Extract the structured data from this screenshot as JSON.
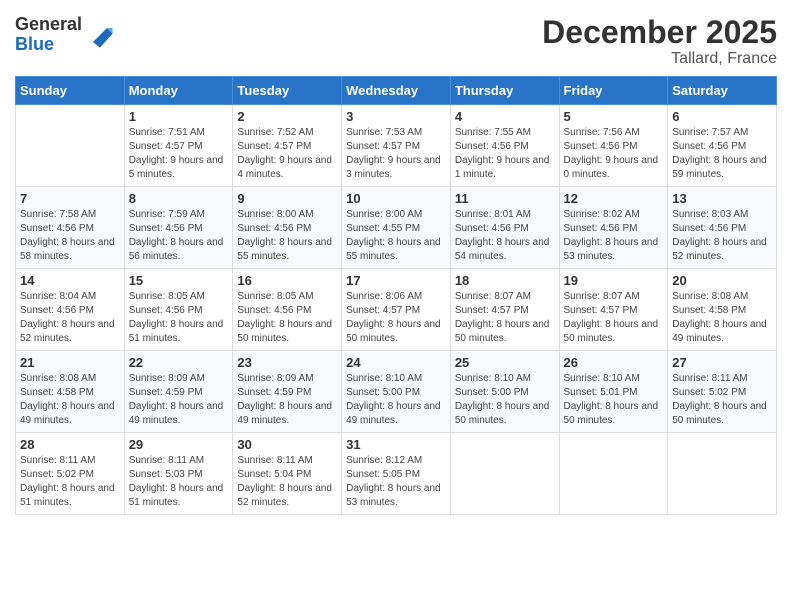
{
  "header": {
    "logo_general": "General",
    "logo_blue": "Blue",
    "month_year": "December 2025",
    "location": "Tallard, France"
  },
  "days_of_week": [
    "Sunday",
    "Monday",
    "Tuesday",
    "Wednesday",
    "Thursday",
    "Friday",
    "Saturday"
  ],
  "weeks": [
    [
      {
        "day": "",
        "sunrise": "",
        "sunset": "",
        "daylight": ""
      },
      {
        "day": "1",
        "sunrise": "Sunrise: 7:51 AM",
        "sunset": "Sunset: 4:57 PM",
        "daylight": "Daylight: 9 hours and 5 minutes."
      },
      {
        "day": "2",
        "sunrise": "Sunrise: 7:52 AM",
        "sunset": "Sunset: 4:57 PM",
        "daylight": "Daylight: 9 hours and 4 minutes."
      },
      {
        "day": "3",
        "sunrise": "Sunrise: 7:53 AM",
        "sunset": "Sunset: 4:57 PM",
        "daylight": "Daylight: 9 hours and 3 minutes."
      },
      {
        "day": "4",
        "sunrise": "Sunrise: 7:55 AM",
        "sunset": "Sunset: 4:56 PM",
        "daylight": "Daylight: 9 hours and 1 minute."
      },
      {
        "day": "5",
        "sunrise": "Sunrise: 7:56 AM",
        "sunset": "Sunset: 4:56 PM",
        "daylight": "Daylight: 9 hours and 0 minutes."
      },
      {
        "day": "6",
        "sunrise": "Sunrise: 7:57 AM",
        "sunset": "Sunset: 4:56 PM",
        "daylight": "Daylight: 8 hours and 59 minutes."
      }
    ],
    [
      {
        "day": "7",
        "sunrise": "Sunrise: 7:58 AM",
        "sunset": "Sunset: 4:56 PM",
        "daylight": "Daylight: 8 hours and 58 minutes."
      },
      {
        "day": "8",
        "sunrise": "Sunrise: 7:59 AM",
        "sunset": "Sunset: 4:56 PM",
        "daylight": "Daylight: 8 hours and 56 minutes."
      },
      {
        "day": "9",
        "sunrise": "Sunrise: 8:00 AM",
        "sunset": "Sunset: 4:56 PM",
        "daylight": "Daylight: 8 hours and 55 minutes."
      },
      {
        "day": "10",
        "sunrise": "Sunrise: 8:00 AM",
        "sunset": "Sunset: 4:55 PM",
        "daylight": "Daylight: 8 hours and 55 minutes."
      },
      {
        "day": "11",
        "sunrise": "Sunrise: 8:01 AM",
        "sunset": "Sunset: 4:56 PM",
        "daylight": "Daylight: 8 hours and 54 minutes."
      },
      {
        "day": "12",
        "sunrise": "Sunrise: 8:02 AM",
        "sunset": "Sunset: 4:56 PM",
        "daylight": "Daylight: 8 hours and 53 minutes."
      },
      {
        "day": "13",
        "sunrise": "Sunrise: 8:03 AM",
        "sunset": "Sunset: 4:56 PM",
        "daylight": "Daylight: 8 hours and 52 minutes."
      }
    ],
    [
      {
        "day": "14",
        "sunrise": "Sunrise: 8:04 AM",
        "sunset": "Sunset: 4:56 PM",
        "daylight": "Daylight: 8 hours and 52 minutes."
      },
      {
        "day": "15",
        "sunrise": "Sunrise: 8:05 AM",
        "sunset": "Sunset: 4:56 PM",
        "daylight": "Daylight: 8 hours and 51 minutes."
      },
      {
        "day": "16",
        "sunrise": "Sunrise: 8:05 AM",
        "sunset": "Sunset: 4:56 PM",
        "daylight": "Daylight: 8 hours and 50 minutes."
      },
      {
        "day": "17",
        "sunrise": "Sunrise: 8:06 AM",
        "sunset": "Sunset: 4:57 PM",
        "daylight": "Daylight: 8 hours and 50 minutes."
      },
      {
        "day": "18",
        "sunrise": "Sunrise: 8:07 AM",
        "sunset": "Sunset: 4:57 PM",
        "daylight": "Daylight: 8 hours and 50 minutes."
      },
      {
        "day": "19",
        "sunrise": "Sunrise: 8:07 AM",
        "sunset": "Sunset: 4:57 PM",
        "daylight": "Daylight: 8 hours and 50 minutes."
      },
      {
        "day": "20",
        "sunrise": "Sunrise: 8:08 AM",
        "sunset": "Sunset: 4:58 PM",
        "daylight": "Daylight: 8 hours and 49 minutes."
      }
    ],
    [
      {
        "day": "21",
        "sunrise": "Sunrise: 8:08 AM",
        "sunset": "Sunset: 4:58 PM",
        "daylight": "Daylight: 8 hours and 49 minutes."
      },
      {
        "day": "22",
        "sunrise": "Sunrise: 8:09 AM",
        "sunset": "Sunset: 4:59 PM",
        "daylight": "Daylight: 8 hours and 49 minutes."
      },
      {
        "day": "23",
        "sunrise": "Sunrise: 8:09 AM",
        "sunset": "Sunset: 4:59 PM",
        "daylight": "Daylight: 8 hours and 49 minutes."
      },
      {
        "day": "24",
        "sunrise": "Sunrise: 8:10 AM",
        "sunset": "Sunset: 5:00 PM",
        "daylight": "Daylight: 8 hours and 49 minutes."
      },
      {
        "day": "25",
        "sunrise": "Sunrise: 8:10 AM",
        "sunset": "Sunset: 5:00 PM",
        "daylight": "Daylight: 8 hours and 50 minutes."
      },
      {
        "day": "26",
        "sunrise": "Sunrise: 8:10 AM",
        "sunset": "Sunset: 5:01 PM",
        "daylight": "Daylight: 8 hours and 50 minutes."
      },
      {
        "day": "27",
        "sunrise": "Sunrise: 8:11 AM",
        "sunset": "Sunset: 5:02 PM",
        "daylight": "Daylight: 8 hours and 50 minutes."
      }
    ],
    [
      {
        "day": "28",
        "sunrise": "Sunrise: 8:11 AM",
        "sunset": "Sunset: 5:02 PM",
        "daylight": "Daylight: 8 hours and 51 minutes."
      },
      {
        "day": "29",
        "sunrise": "Sunrise: 8:11 AM",
        "sunset": "Sunset: 5:03 PM",
        "daylight": "Daylight: 8 hours and 51 minutes."
      },
      {
        "day": "30",
        "sunrise": "Sunrise: 8:11 AM",
        "sunset": "Sunset: 5:04 PM",
        "daylight": "Daylight: 8 hours and 52 minutes."
      },
      {
        "day": "31",
        "sunrise": "Sunrise: 8:12 AM",
        "sunset": "Sunset: 5:05 PM",
        "daylight": "Daylight: 8 hours and 53 minutes."
      },
      {
        "day": "",
        "sunrise": "",
        "sunset": "",
        "daylight": ""
      },
      {
        "day": "",
        "sunrise": "",
        "sunset": "",
        "daylight": ""
      },
      {
        "day": "",
        "sunrise": "",
        "sunset": "",
        "daylight": ""
      }
    ]
  ]
}
